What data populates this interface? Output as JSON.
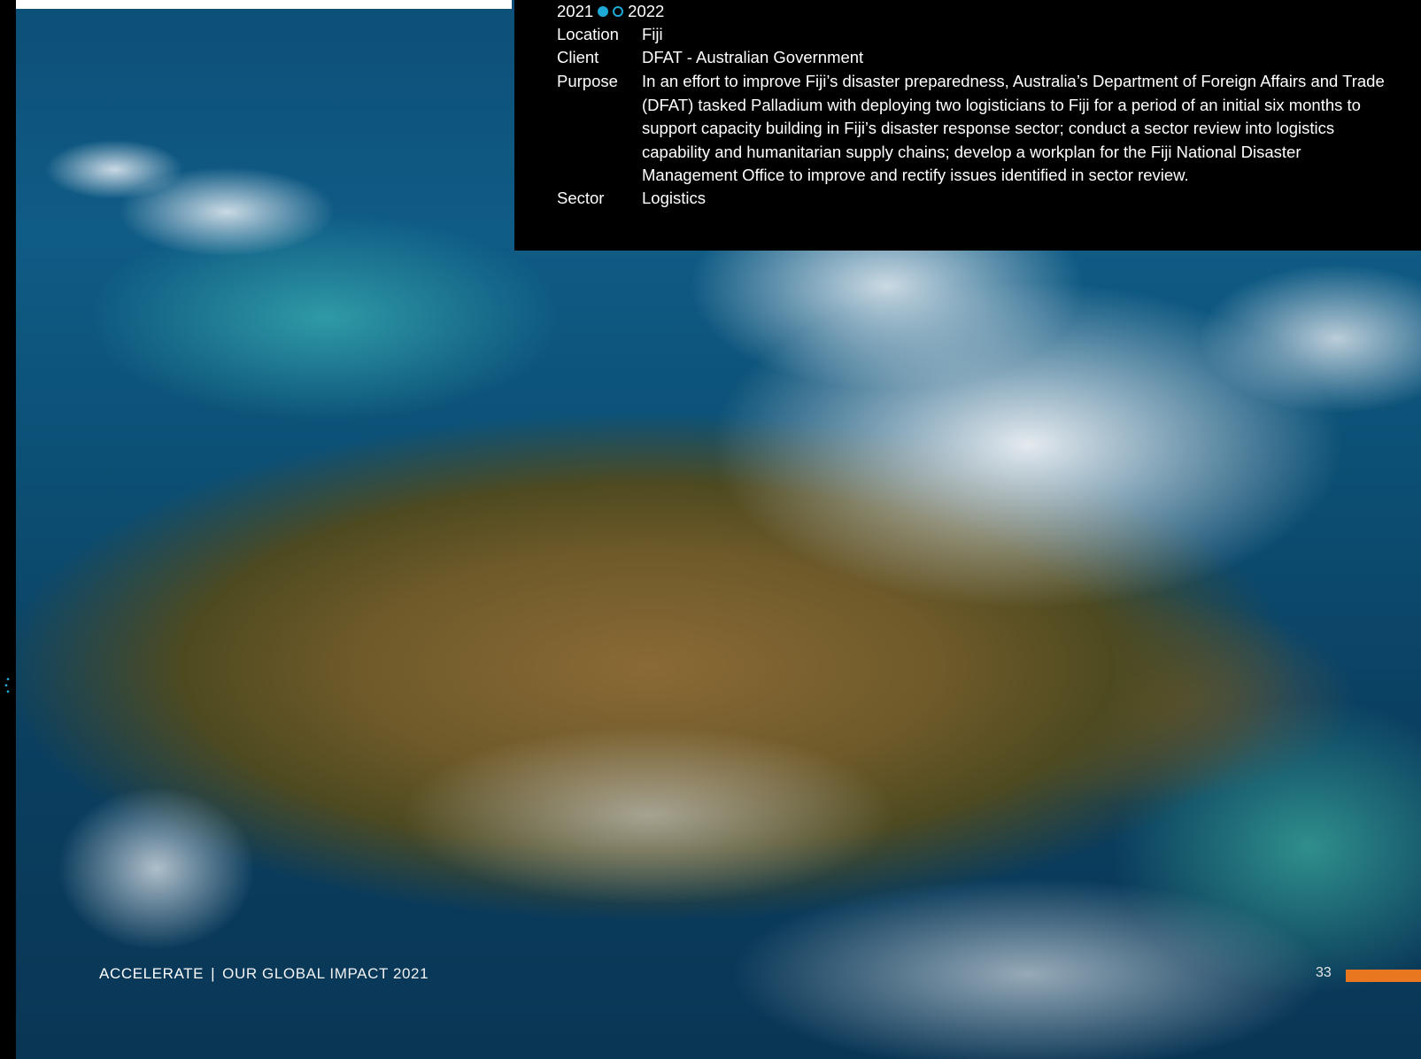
{
  "colors": {
    "accent_dot": "#1fa9d6",
    "footer_bar": "#e8771f",
    "panel_background": "#000000"
  },
  "info": {
    "year_start": "2021",
    "year_end": "2022",
    "rows": [
      {
        "label": "Location",
        "value": "Fiji"
      },
      {
        "label": "Client",
        "value": "DFAT - Australian Government"
      },
      {
        "label": "Purpose",
        "value": "In an effort to improve Fiji’s disaster preparedness, Australia’s Department of Foreign Affairs and Trade (DFAT) tasked Palladium with deploying two logisticians to Fiji for a period of an initial six months to support capacity building in Fiji’s disaster response sector; conduct a sector review into logistics capability and humanitarian supply chains; develop a workplan for the Fiji National Disaster Management Office to improve and rectify issues identified in sector review."
      },
      {
        "label": "Sector",
        "value": "Logistics"
      }
    ]
  },
  "footer": {
    "brand": "ACCELERATE",
    "separator": "|",
    "subtitle": "OUR GLOBAL IMPACT 2021",
    "page_number": "33"
  }
}
